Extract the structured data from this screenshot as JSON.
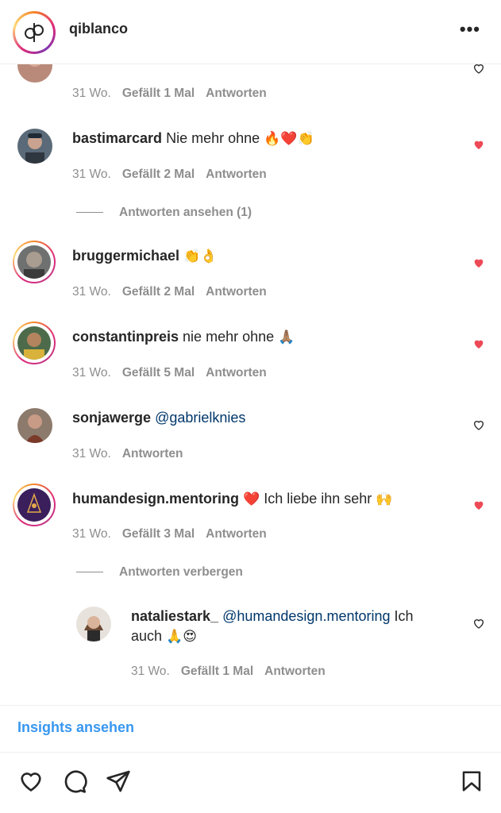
{
  "header": {
    "username": "qiblanco",
    "more_label": "•••"
  },
  "comments": [
    {
      "username": "",
      "text": "",
      "time": "31 Wo.",
      "likes": "Gefällt 1 Mal",
      "reply": "Antworten",
      "liked": false
    },
    {
      "username": "bastimarcard",
      "text": "Nie mehr ohne",
      "emoji": "🔥❤️👏",
      "time": "31 Wo.",
      "likes": "Gefällt 2 Mal",
      "reply": "Antworten",
      "liked": true,
      "view_replies": "Antworten ansehen (1)"
    },
    {
      "username": "bruggermichael",
      "text": "",
      "emoji": "👏👌",
      "time": "31 Wo.",
      "likes": "Gefällt 2 Mal",
      "reply": "Antworten",
      "liked": true
    },
    {
      "username": "constantinpreis",
      "text": "nie mehr ohne",
      "emoji": "🙏🏽",
      "time": "31 Wo.",
      "likes": "Gefällt 5 Mal",
      "reply": "Antworten",
      "liked": true
    },
    {
      "username": "sonjawerge",
      "mention": "@gabrielknies",
      "time": "31 Wo.",
      "reply": "Antworten",
      "liked": false
    },
    {
      "username": "humandesign.mentoring",
      "emoji_pre": "❤️",
      "text": "Ich liebe ihn sehr",
      "emoji": "🙌",
      "time": "31 Wo.",
      "likes": "Gefällt 3 Mal",
      "reply": "Antworten",
      "liked": true,
      "hide_replies": "Antworten verbergen"
    }
  ],
  "reply": {
    "username": "nataliestark_",
    "mention": "@humandesign.mentoring",
    "text_line1_end": "Ich",
    "text_line2": "auch",
    "emoji": "🙏😍",
    "time": "31 Wo.",
    "likes": "Gefällt 1 Mal",
    "reply": "Antworten",
    "liked": false
  },
  "insights_label": "Insights ansehen",
  "colors": {
    "heart_liked": "#ed4956",
    "link_blue": "#3897f0",
    "mention": "#00376b",
    "meta_gray": "#8e8e8e"
  },
  "icons": {
    "like": "heart-outline-icon",
    "comment": "comment-bubble-icon",
    "share": "paper-plane-icon",
    "save": "bookmark-icon"
  }
}
